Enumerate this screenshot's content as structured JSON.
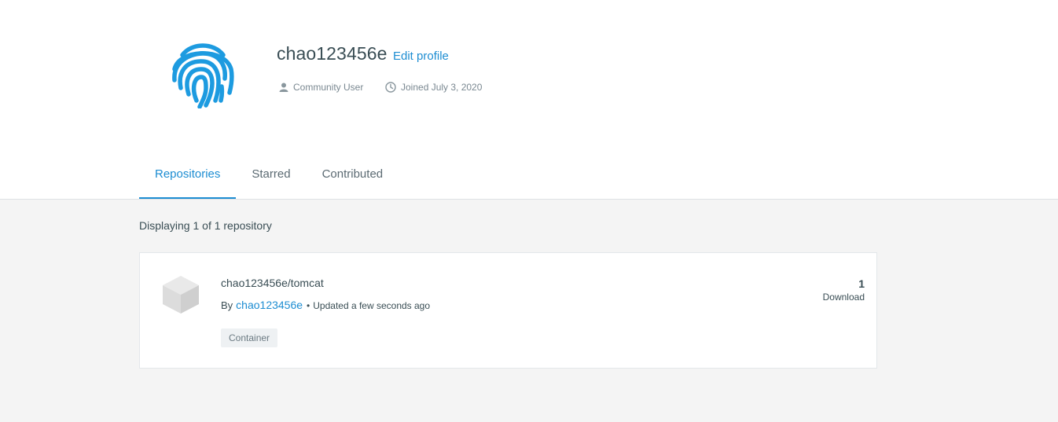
{
  "profile": {
    "username": "chao123456e",
    "edit_label": "Edit profile",
    "role": "Community User",
    "joined": "Joined July 3, 2020",
    "avatar_icon": "fingerprint-icon",
    "accent_color": "#1d8dd2"
  },
  "tabs": [
    {
      "label": "Repositories",
      "active": true
    },
    {
      "label": "Starred",
      "active": false
    },
    {
      "label": "Contributed",
      "active": false
    }
  ],
  "listing": {
    "count_text": "Displaying 1 of 1 repository"
  },
  "repositories": [
    {
      "name": "chao123456e/tomcat",
      "by_label": "By",
      "owner": "chao123456e",
      "bullet": "•",
      "updated": "Updated a few seconds ago",
      "badge": "Container",
      "downloads": "1",
      "downloads_label": "Download",
      "icon": "cube-icon"
    }
  ]
}
